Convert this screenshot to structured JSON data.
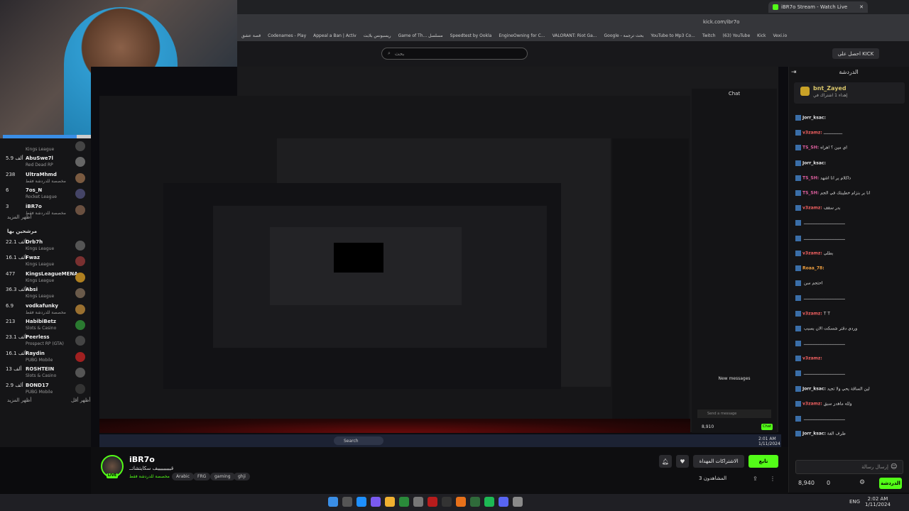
{
  "browser": {
    "tab_title": "iBR7o Stream - Watch Live",
    "url": "kick.com/ibr7o",
    "bookmarks": [
      "قصة عشق",
      "Codenames - Play",
      "Appeal a Ban | Activ",
      "ريسبونس بلابت",
      "Game of Th... مسلسل",
      "Speedtest by Ookla",
      "EngineOwning for C...",
      "VALORANT: Riot Ga...",
      "Google - بحث ترجمة",
      "YouTube to Mp3 Co...",
      "Twitch",
      "(63) YouTube",
      "Kick",
      "Vexi.io"
    ]
  },
  "site": {
    "search_placeholder": "بحث",
    "get_kick_label": "احصل على KICK"
  },
  "sidebar": {
    "top_items": [
      {
        "count": "",
        "name": "",
        "sub": "Kings League",
        "color": "#444"
      },
      {
        "count": "5.9 ألف",
        "name": "AbuSwe7l",
        "sub": "Red Dead RP",
        "color": "#666"
      },
      {
        "count": "238",
        "name": "UltraMhmd",
        "sub": "مخصصة للدردشة فقط",
        "color": "#7a5a40"
      },
      {
        "count": "6",
        "name": "7os_N",
        "sub": "Rocket League",
        "color": "#446"
      },
      {
        "count": "3",
        "name": "iBR7o",
        "sub": "مخصصة للدردشة فقط",
        "color": "#6a5040"
      }
    ],
    "show_more_1": "أظهر المزيد",
    "recommended_header": "مرشحين بها",
    "rec_items": [
      {
        "count": "22.1 ألف",
        "name": "Drb7h",
        "sub": "Kings League",
        "color": "#555"
      },
      {
        "count": "16.1 ألف",
        "name": "Fwaz",
        "sub": "Kings League",
        "color": "#7a3030"
      },
      {
        "count": "477",
        "name": "KingsLeagueMENA",
        "sub": "Kings League",
        "color": "#b08020"
      },
      {
        "count": "36.3 ألف",
        "name": "Absi",
        "sub": "Kings League",
        "color": "#6a5a4a"
      },
      {
        "count": "6.9",
        "name": "vodkafunky",
        "sub": "مخصصة للدردشة فقط",
        "color": "#9a7030"
      },
      {
        "count": "213",
        "name": "HabibiBetz",
        "sub": "Slots & Casino",
        "color": "#2a7a30"
      },
      {
        "count": "23.1 ألف",
        "name": "Peerless",
        "sub": "Prospect RP (GTA)",
        "color": "#444"
      },
      {
        "count": "16.1 ألف",
        "name": "Raydin",
        "sub": "PUBG Mobile",
        "color": "#a02020"
      },
      {
        "count": "13 ألف",
        "name": "ROSHTEIN",
        "sub": "Slots & Casino",
        "color": "#555"
      },
      {
        "count": "2.9 ألف",
        "name": "BOND17",
        "sub": "PUBG Mobile",
        "color": "#333"
      }
    ],
    "show_more_2": "أظهر المزيد",
    "show_less": "أظهر أقل"
  },
  "chat": {
    "title": "الدردشة",
    "pinned_user": "bnt_Zayed",
    "pinned_text": "إهداء 1 اشتراك في ",
    "messages": [
      {
        "user": "Jorr_ksac:",
        "text": "",
        "color": "#e8e8ea"
      },
      {
        "user": "v3zamz:",
        "text": "ـــــــــــــــ",
        "color": "#f06060"
      },
      {
        "user": "TS_SH:",
        "text": "اي مين ؟ اهراه",
        "color": "#e060a0"
      },
      {
        "user": "Jorr_ksac:",
        "text": "",
        "color": "#e8e8ea"
      },
      {
        "user": "TS_SH:",
        "text": "ذاكلام ير انا اشهد",
        "color": "#e060a0"
      },
      {
        "user": "TS_SH:",
        "text": "انا بر بنزام خطيبتك في الجم",
        "color": "#e060a0"
      },
      {
        "user": "v3zamz:",
        "text": "بدر سقف",
        "color": "#f06060"
      },
      {
        "user": "",
        "text": "ـــــــــــــــــــــــــــــــــ",
        "color": "#e8e8ea"
      },
      {
        "user": "",
        "text": "ـــــــــــــــــــــــــــــــــ",
        "color": "#e8e8ea"
      },
      {
        "user": "v3zamz:",
        "text": "بطلي",
        "color": "#f06060"
      },
      {
        "user": "Roaa_78:",
        "text": "",
        "color": "#f0a040"
      },
      {
        "user": "",
        "text": "احتجم سن",
        "color": "#e8e8ea"
      },
      {
        "user": "",
        "text": "ـــــــــــــــــــــــــــــــــ",
        "color": "#e8e8ea"
      },
      {
        "user": "v3zamz:",
        "text": "T T",
        "color": "#f06060"
      },
      {
        "user": "",
        "text": "وردي دقتر شسكت الان بسبب",
        "color": "#e8e8ea"
      },
      {
        "user": "",
        "text": "ـــــــــــــــــــــــــــــــــ",
        "color": "#e8e8ea"
      },
      {
        "user": "v3zamz:",
        "text": "",
        "color": "#f06060"
      },
      {
        "user": "",
        "text": "ـــــــــــــــــــــــــــــــــ",
        "color": "#e8e8ea"
      },
      {
        "user": "Jorr_ksac:",
        "text": "لين الساقة يحي ولا تجيد",
        "color": "#e8e8ea"
      },
      {
        "user": "v3zamz:",
        "text": "ولله ماهدز سبق",
        "color": "#f06060"
      },
      {
        "user": "",
        "text": "ـــــــــــــــــــــــــــــــــ",
        "color": "#e8e8ea"
      },
      {
        "user": "Jorr_ksac:",
        "text": "طرف الفة",
        "color": "#e8e8ea"
      }
    ],
    "input_placeholder": "إرسال رسالة",
    "points": "8,940",
    "zero": "0",
    "send_label": "الدردشة"
  },
  "inner_chat": {
    "title": "Chat",
    "send_placeholder": "Send a message",
    "points": "8,910",
    "new_messages": "New messages",
    "send_label": "Chat"
  },
  "stream": {
    "streamer": "iBR7o",
    "live_label": "LIVE",
    "title": "قيييييييييف سكايتشاتــ",
    "category": "مخصصة للدردشة فقط",
    "tags": [
      "Arabic",
      "FRG",
      "gaming",
      "ghji"
    ],
    "follow_label": "تابع",
    "subscribe_label": "الاشتراكات المهداة",
    "viewers": "المشاهدون 3"
  },
  "inner_taskbar": {
    "search_label": "Search",
    "time": "2:01 AM",
    "date": "1/11/2024"
  },
  "taskbar": {
    "lang": "ENG",
    "time": "2:02 AM",
    "date": "1/11/2024",
    "icon_colors": [
      "#3a8ee6",
      "#555",
      "#1e90ff",
      "#7a5af0",
      "#f0b030",
      "#2a8a3a",
      "#777",
      "#b71c1c",
      "#333",
      "#e8711a",
      "#2f6a3a",
      "#1db954",
      "#5865f2",
      "#8a8a8a"
    ]
  }
}
